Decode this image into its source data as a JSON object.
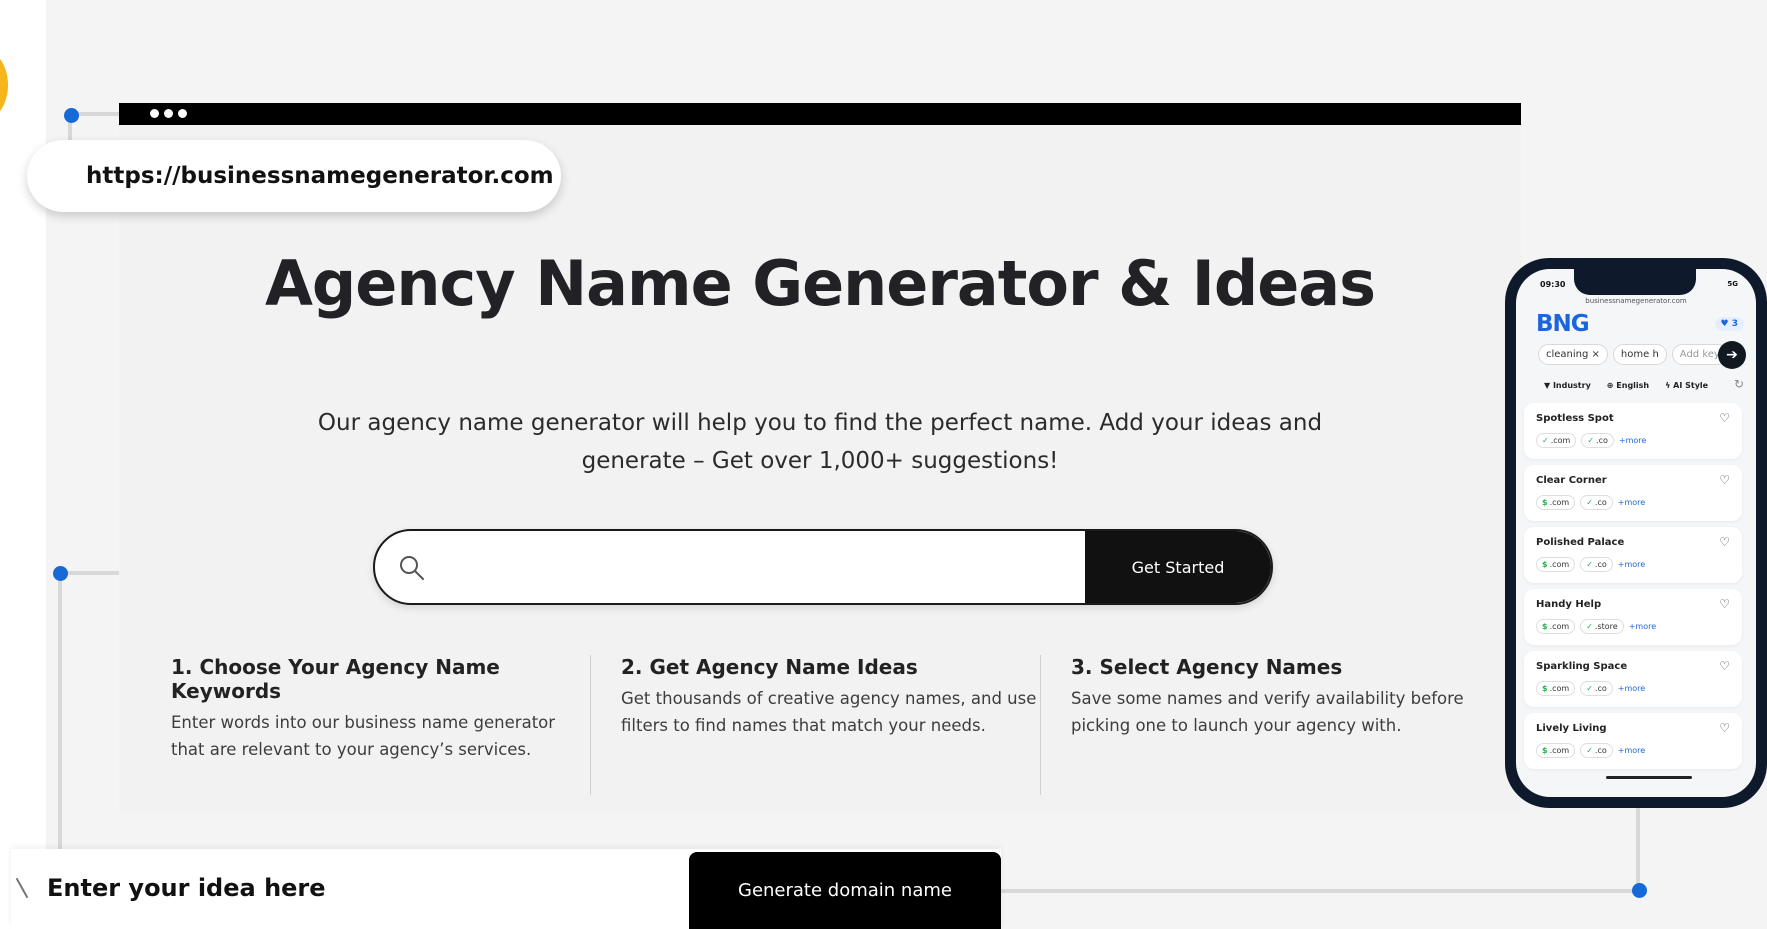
{
  "browser": {
    "url": "https://businessnamegenerator.com"
  },
  "hero": {
    "title": "Agency Name Generator & Ideas",
    "subtitle": "Our agency name generator will help you to find the perfect name. Add your ideas and generate – Get over 1,000+ suggestions!"
  },
  "search": {
    "placeholder": "",
    "button_label": "Get Started"
  },
  "steps": [
    {
      "title": "1. Choose Your Agency Name Keywords",
      "text": "Enter words into our business name generator that are relevant to your agency’s services."
    },
    {
      "title": "2. Get Agency Name Ideas",
      "text": "Get thousands of creative agency names, and use filters to find names that match your needs."
    },
    {
      "title": "3. Select Agency Names",
      "text": "Save some names and verify availability before picking one to launch your agency with."
    }
  ],
  "phone": {
    "time": "09:30",
    "signal": "5G",
    "url": "businessnamegenerator.com",
    "logo": "BNG",
    "favorites_count": "3",
    "chips": [
      "cleaning ×",
      "home h",
      "Add key"
    ],
    "filters": [
      "Industry",
      "English",
      "AI Style"
    ],
    "names": [
      {
        "name": "Spotless Spot",
        "tags": [
          {
            "mark": "✓",
            "ext": ".com"
          },
          {
            "mark": "✓",
            "ext": ".co"
          }
        ],
        "more": "+more"
      },
      {
        "name": "Clear Corner",
        "tags": [
          {
            "mark": "$",
            "ext": ".com"
          },
          {
            "mark": "✓",
            "ext": ".co"
          }
        ],
        "more": "+more"
      },
      {
        "name": "Polished Palace",
        "tags": [
          {
            "mark": "$",
            "ext": ".com"
          },
          {
            "mark": "✓",
            "ext": ".co"
          }
        ],
        "more": "+more"
      },
      {
        "name": "Handy Help",
        "tags": [
          {
            "mark": "$",
            "ext": ".com"
          },
          {
            "mark": "✓",
            "ext": ".store"
          }
        ],
        "more": "+more"
      },
      {
        "name": "Sparkling Space",
        "tags": [
          {
            "mark": "$",
            "ext": ".com"
          },
          {
            "mark": "✓",
            "ext": ".co"
          }
        ],
        "more": "+more"
      },
      {
        "name": "Lively Living",
        "tags": [
          {
            "mark": "$",
            "ext": ".com"
          },
          {
            "mark": "✓",
            "ext": ".co"
          }
        ],
        "more": "+more"
      }
    ]
  },
  "bottom": {
    "input_value": "Enter your idea here",
    "button_label": "Generate domain name"
  },
  "colors": {
    "accent_blue": "#1669d6",
    "dark": "#111111",
    "accent_yellow": "#f6b51a"
  }
}
